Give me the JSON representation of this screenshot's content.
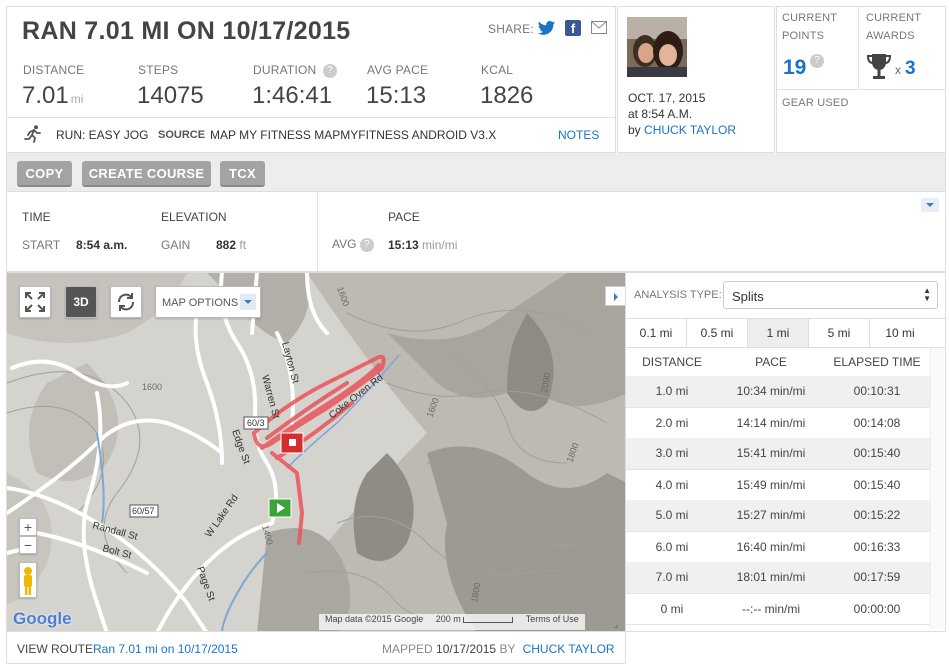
{
  "header": {
    "title": "RAN 7.01 MI ON 10/17/2015",
    "share_label": "SHARE:"
  },
  "stats": {
    "distance": {
      "label": "DISTANCE",
      "value": "7.01",
      "unit": "mi"
    },
    "steps": {
      "label": "STEPS",
      "value": "14075"
    },
    "duration": {
      "label": "DURATION",
      "value": "1:46:41",
      "help": "?"
    },
    "avg_pace": {
      "label": "AVG PACE",
      "value": "15:13"
    },
    "kcal": {
      "label": "KCAL",
      "value": "1826"
    }
  },
  "activity": {
    "type": "RUN: EASY JOG",
    "source_label": "SOURCE",
    "source_value": "MAP MY FITNESS MAPMYFITNESS ANDROID V3.X",
    "notes_label": "NOTES"
  },
  "user": {
    "date": "OCT. 17, 2015",
    "time": "at 8:54 A.M.",
    "by_label": "by",
    "name": "CHUCK TAYLOR"
  },
  "points": {
    "label_1": "CURRENT",
    "label_2": "POINTS",
    "value": "19",
    "help": "?"
  },
  "awards": {
    "label_1": "CURRENT",
    "label_2": "AWARDS",
    "x": "x",
    "value": "3"
  },
  "gear": {
    "label": "GEAR USED"
  },
  "buttons": {
    "copy": "COPY",
    "create_course": "CREATE COURSE",
    "tcx": "TCX"
  },
  "time_section": {
    "title": "TIME",
    "start_label": "START",
    "start_value": "8:54 a.m."
  },
  "elevation": {
    "title": "ELEVATION",
    "gain_label": "GAIN",
    "gain_value": "882",
    "gain_unit": "ft"
  },
  "pace_section": {
    "title": "PACE",
    "avg_label": "AVG",
    "help": "?",
    "avg_value": "15:13",
    "avg_unit": "min/mi"
  },
  "map": {
    "options_label": "MAP OPTIONS",
    "threeD": "3D",
    "zoom_in": "+",
    "zoom_out": "−",
    "google": "Google",
    "attribution": "Map data ©2015 Google",
    "scale": "200 m",
    "terms": "Terms of Use",
    "labels": {
      "layton": "Layton St",
      "warren": "Warren St",
      "edge": "Edge St",
      "coke_oven": "Coke Oven Rd",
      "w_lake": "W Lake Rd",
      "randall": "Randall St",
      "bolt": "Bolt St",
      "page": "Page St",
      "route_60_3": "60/3",
      "route_60_57": "60/57",
      "c1600a": "1600",
      "c1600b": "1600",
      "c1600c": "1600",
      "c2000": "2000",
      "c1400": "1400",
      "c1800a": "1800",
      "c1800b": "1800"
    }
  },
  "analysis": {
    "label": "ANALYSIS TYPE:",
    "selected": "Splits",
    "tabs": [
      "0.1 mi",
      "0.5 mi",
      "1 mi",
      "5 mi",
      "10 mi"
    ],
    "active_tab": 2,
    "columns": [
      "DISTANCE",
      "PACE",
      "ELAPSED TIME"
    ],
    "rows": [
      [
        "1.0 mi",
        "10:34 min/mi",
        "00:10:31"
      ],
      [
        "2.0 mi",
        "14:14 min/mi",
        "00:14:08"
      ],
      [
        "3.0 mi",
        "15:41 min/mi",
        "00:15:40"
      ],
      [
        "4.0 mi",
        "15:49 min/mi",
        "00:15:40"
      ],
      [
        "5.0 mi",
        "15:27 min/mi",
        "00:15:22"
      ],
      [
        "6.0 mi",
        "16:40 min/mi",
        "00:16:33"
      ],
      [
        "7.0 mi",
        "18:01 min/mi",
        "00:17:59"
      ],
      [
        "0 mi",
        "--:-- min/mi",
        "00:00:00"
      ]
    ]
  },
  "footer": {
    "view_route_label": "VIEW ROUTE",
    "route_link": "Ran 7.01 mi on 10/17/2015",
    "mapped_label": "MAPPED",
    "mapped_date": "10/17/2015",
    "by_label": "BY",
    "mapped_by": "CHUCK TAYLOR"
  }
}
